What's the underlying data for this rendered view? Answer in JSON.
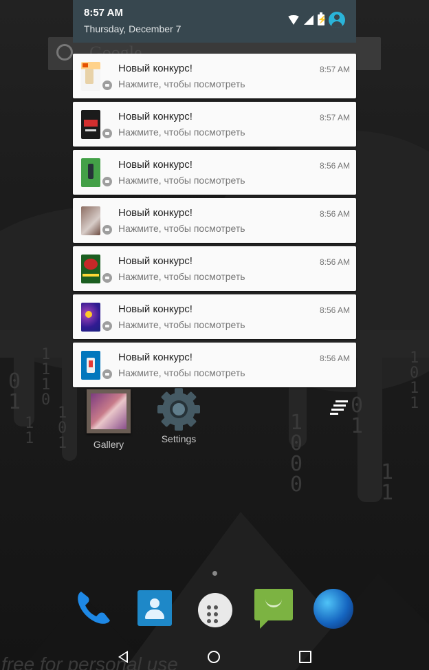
{
  "status": {
    "time": "8:57 AM",
    "date": "Thursday, December 7"
  },
  "search": {
    "hint": "Google"
  },
  "notifications": [
    {
      "title": "Новый конкурс!",
      "text": "Нажмите, чтобы посмотреть",
      "time": "8:57 AM"
    },
    {
      "title": "Новый конкурс!",
      "text": "Нажмите, чтобы посмотреть",
      "time": "8:57 AM"
    },
    {
      "title": "Новый конкурс!",
      "text": "Нажмите, чтобы посмотреть",
      "time": "8:56 AM"
    },
    {
      "title": "Новый конкурс!",
      "text": "Нажмите, чтобы посмотреть",
      "time": "8:56 AM"
    },
    {
      "title": "Новый конкурс!",
      "text": "Нажмите, чтобы посмотреть",
      "time": "8:56 AM"
    },
    {
      "title": "Новый конкурс!",
      "text": "Нажмите, чтобы посмотреть",
      "time": "8:56 AM"
    },
    {
      "title": "Новый конкурс!",
      "text": "Нажмите, чтобы посмотреть",
      "time": "8:56 AM"
    }
  ],
  "home": {
    "apps": [
      {
        "label": "Gallery",
        "icon": "gallery-icon"
      },
      {
        "label": "Settings",
        "icon": "gear-icon"
      }
    ],
    "dock": [
      "phone-icon",
      "contacts-icon",
      "app-drawer-icon",
      "messaging-icon",
      "browser-icon"
    ]
  },
  "wallpaper": {
    "watermark": "free for personal use",
    "binary_columns": [
      "0\n1",
      "1\n1\n1\n0",
      "1\n0\n1",
      "1\n0\n0\n0",
      "0\n1",
      "1\n1",
      "1\n0\n1\n1",
      "1\n1"
    ]
  },
  "colors": {
    "shade_header": "#37474f",
    "notification_bg": "#fafafa",
    "accent": "#2ab4d9"
  }
}
